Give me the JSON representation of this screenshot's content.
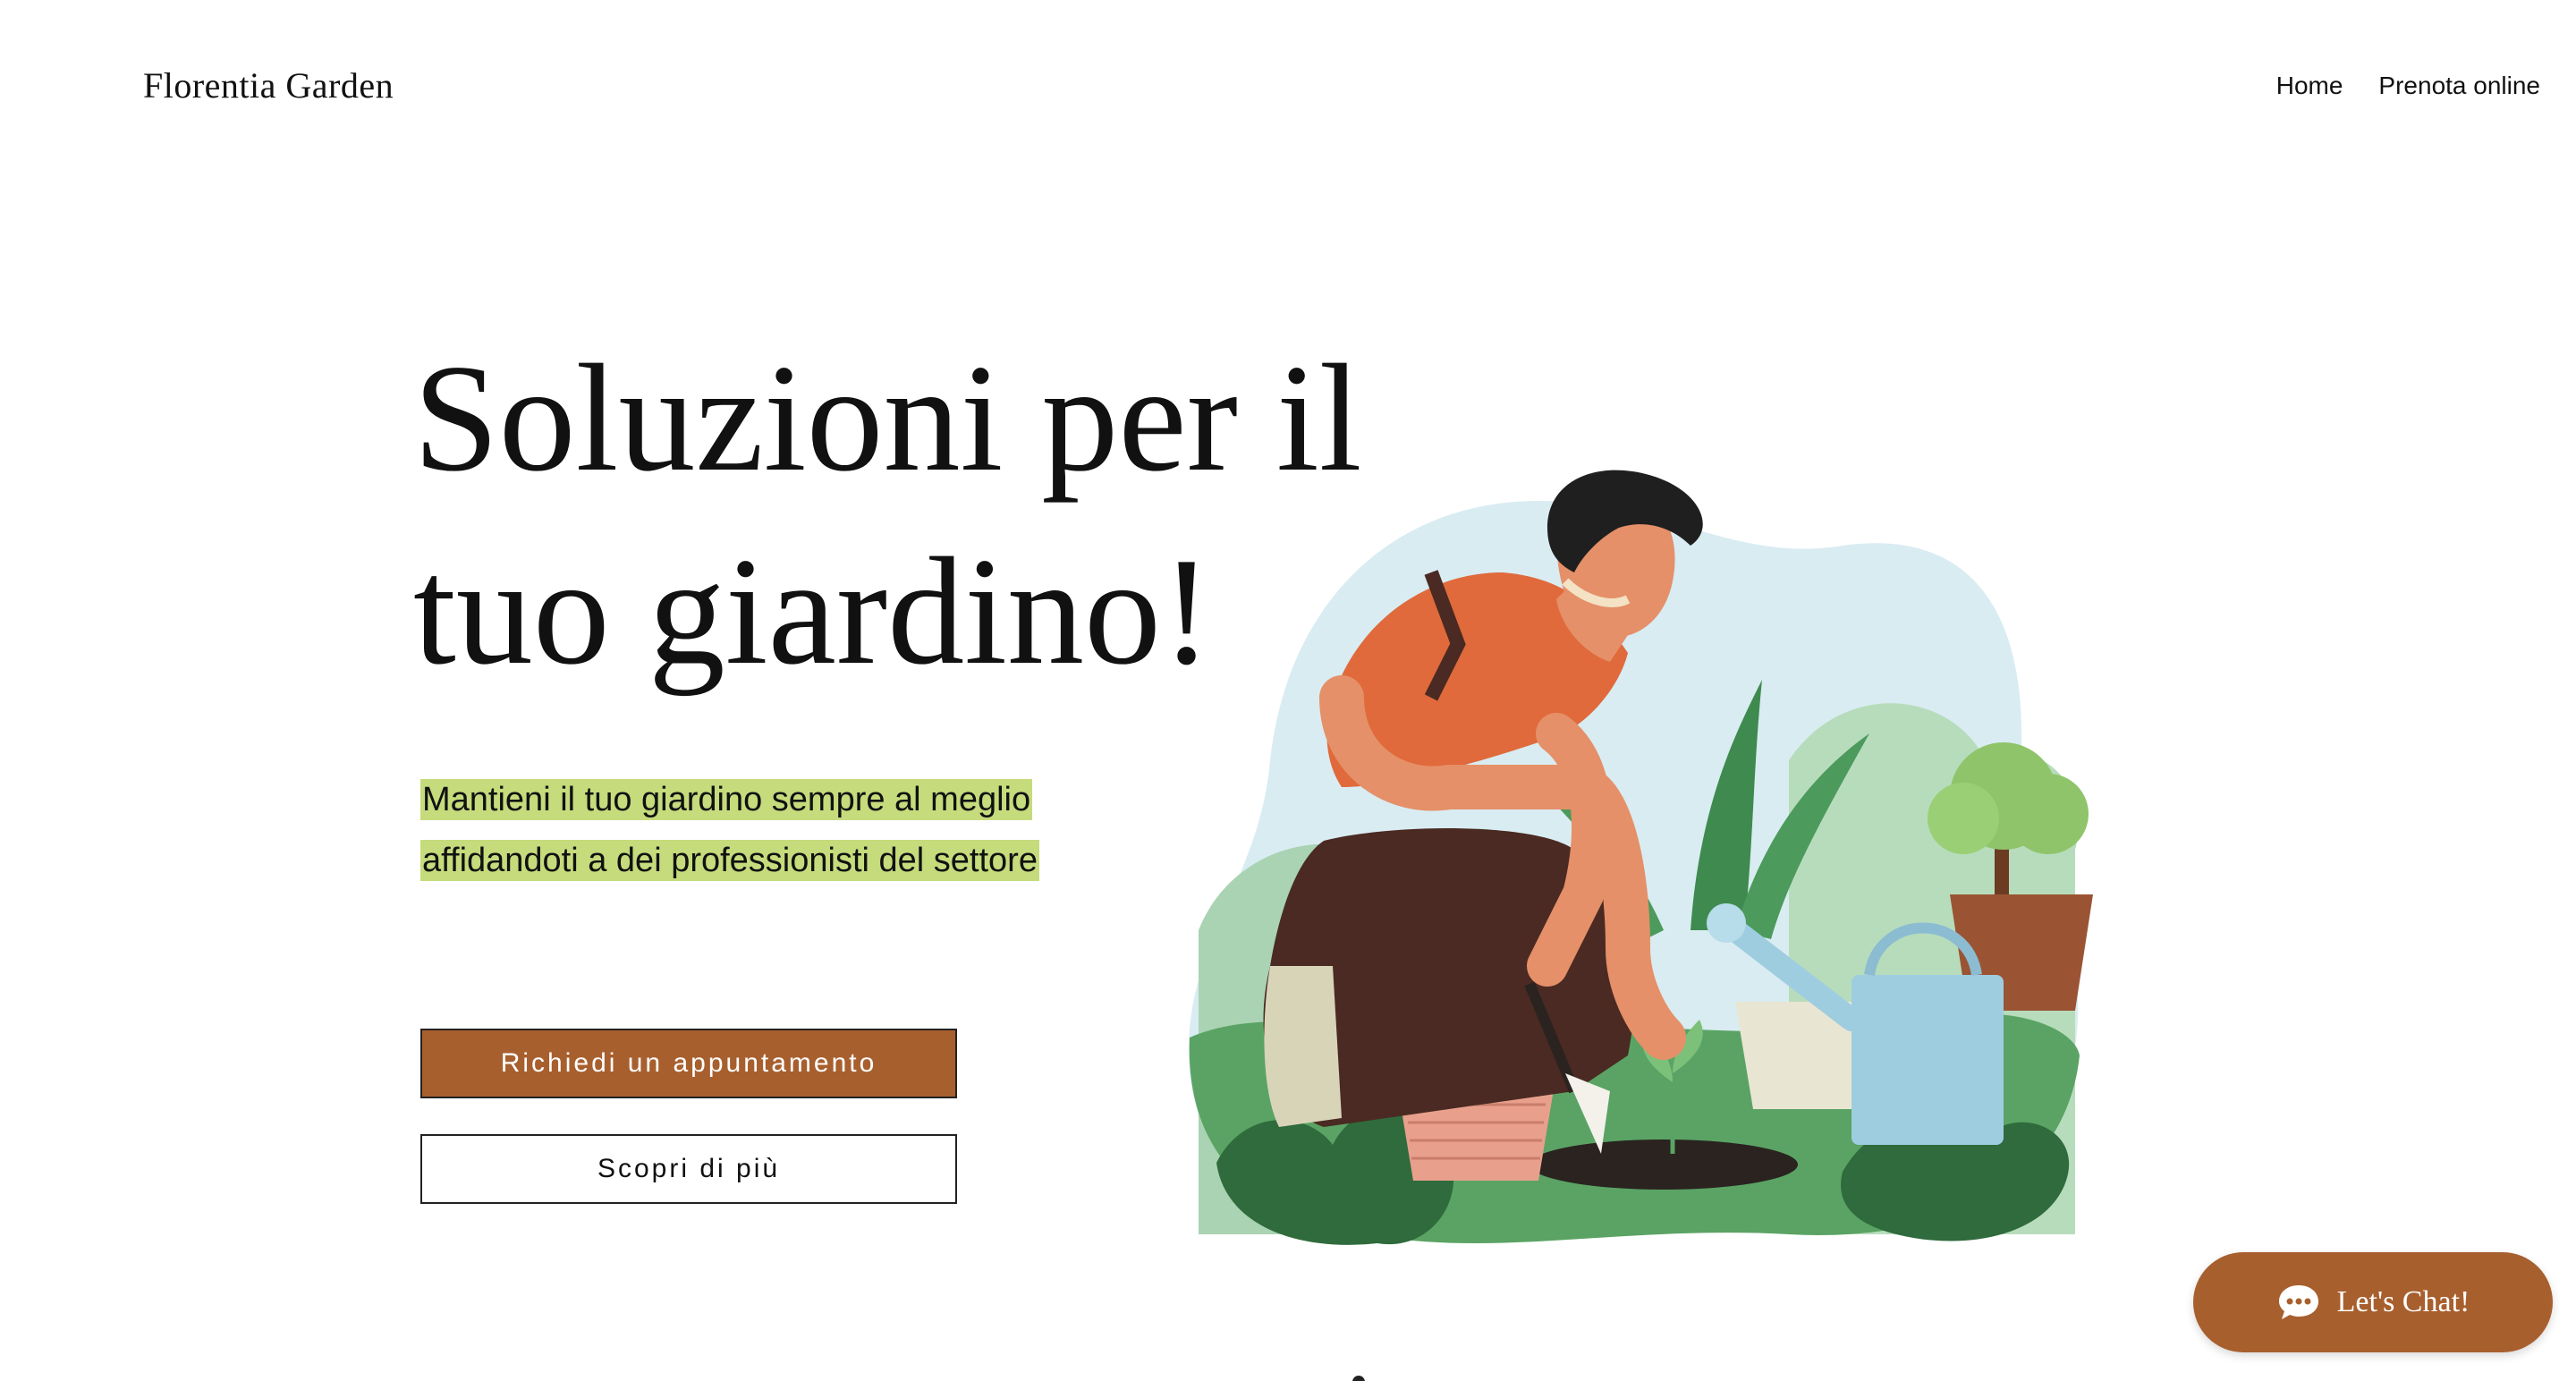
{
  "header": {
    "brand": "Florentia Garden",
    "nav": [
      {
        "label": "Home"
      },
      {
        "label": "Prenota online"
      }
    ]
  },
  "hero": {
    "title_line1": "Soluzioni per il",
    "title_line2": "tuo giardino!",
    "subtitle": "Mantieni il tuo giardino sempre al meglio affidandoti a dei professionisti del settore",
    "primary_button": "Richiedi un appuntamento",
    "secondary_button": "Scopri di più"
  },
  "chat": {
    "label": "Let's Chat!"
  },
  "colors": {
    "accent": "#a85f2e",
    "highlight": "#c5db7c"
  },
  "icons": {
    "chat": "chat-bubble-icon",
    "illustration": "gardener-illustration"
  }
}
